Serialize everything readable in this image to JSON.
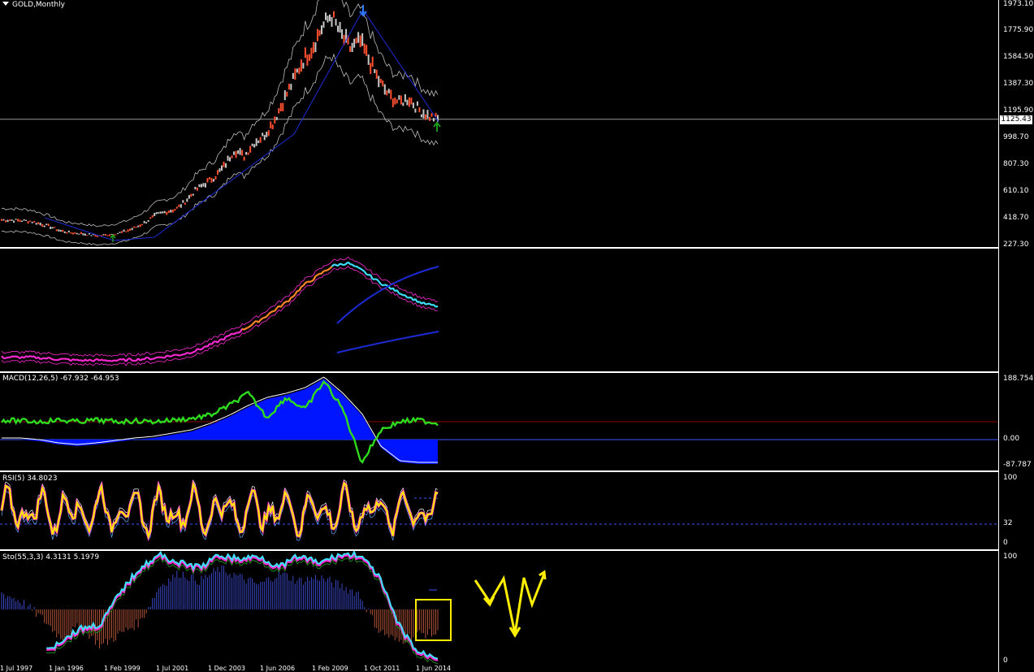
{
  "chart_data": [
    {
      "type": "line",
      "title": "GOLD,Monthly",
      "yticks": [
        "1973.10",
        "1775.90",
        "1584.50",
        "1387.30",
        "1195.90",
        "998.70",
        "807.30",
        "610.10",
        "418.70",
        "227.30"
      ],
      "ylim": [
        227.3,
        1973.1
      ],
      "current_price": "1125.43",
      "series": [
        {
          "values": [
            380,
            378,
            375,
            370,
            350,
            330,
            300,
            285,
            280,
            270,
            262,
            270,
            280,
            300,
            330,
            370,
            420,
            440,
            460,
            520,
            600,
            650,
            700,
            780,
            900,
            850,
            950,
            1000,
            1100,
            1250,
            1400,
            1550,
            1650,
            1800,
            1900,
            1750,
            1650,
            1700,
            1550,
            1400,
            1300,
            1250,
            1280,
            1200,
            1150,
            1125
          ]
        }
      ]
    },
    {
      "type": "line",
      "title": "",
      "series": [
        {
          "values": [
            0.05,
            0.05,
            0.05,
            0.04,
            0.03,
            0.02,
            0.02,
            0.02,
            0.02,
            0.03,
            0.04,
            0.06,
            0.08,
            0.12,
            0.18,
            0.25,
            0.32,
            0.4,
            0.5,
            0.6,
            0.75,
            0.85,
            0.95,
            0.98,
            0.9,
            0.8,
            0.72,
            0.65,
            0.58,
            0.55
          ]
        }
      ]
    },
    {
      "type": "bar",
      "title": "MACD(12,26,5) -67.932 -64.953",
      "yticks": [
        "188.754",
        "0.00",
        "-87.787"
      ],
      "ylim": [
        -87.787,
        188.754
      ]
    },
    {
      "type": "line",
      "title": "RSI(5) 34.8023",
      "yticks": [
        "100",
        "32",
        "0"
      ],
      "ylim": [
        0,
        100
      ]
    },
    {
      "type": "bar",
      "title": "Sto(55,3,3) 4.3131 5.1979",
      "yticks": [
        "100",
        "0"
      ],
      "ylim": [
        0,
        100
      ]
    }
  ],
  "colors": {
    "background": "#000000",
    "up_candle": "#ff4f2e",
    "trendline": "#1d2bd6",
    "band": "#ffffff",
    "cyan": "#3fe2ff",
    "orange": "#ff8a2a",
    "magenta": "#ff2bd5",
    "macd_hist": "#0015ff",
    "macd_signal": "#2edc1d",
    "rsi": "#ffe600",
    "annotation": "#ffee00"
  },
  "xlabels": [
    "1 Jul 1997",
    "1 Jan 1996",
    "1 Feb 1999",
    "1 Jul 2001",
    "1 Dec 2003",
    "1 Jun 2006",
    "1 Feb 2009",
    "1 Oct 2011",
    "1 Jun 2014"
  ]
}
